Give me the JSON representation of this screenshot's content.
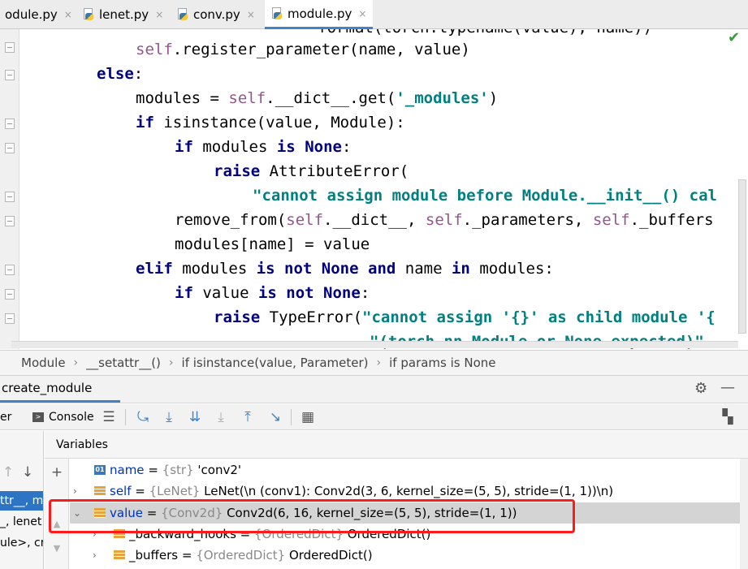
{
  "tabs": [
    {
      "label": "odule.py",
      "active": false
    },
    {
      "label": "lenet.py",
      "active": false
    },
    {
      "label": "conv.py",
      "active": false
    },
    {
      "label": "module.py",
      "active": true
    }
  ],
  "tab_close": "×",
  "editor": {
    "line0": "    \"format(torch.typename(value), name))",
    "line1_self": "self",
    "line1_rest": ".register_parameter(name, value)",
    "line2_kw": "else",
    "line2_rest": ":",
    "line3_a": "modules = ",
    "line3_self": "self",
    "line3_b": ".__dict__.get(",
    "line3_str": "'_modules'",
    "line3_c": ")",
    "line4_kw": "if",
    "line4_rest": " isinstance(value, Module):",
    "line5_kw1": "if",
    "line5_mid": " modules ",
    "line5_kw2": "is",
    "line5_sp": " ",
    "line5_kw3": "None",
    "line5_end": ":",
    "line6_kw": "raise",
    "line6_rest": " AttributeError(",
    "line7_str": "\"cannot assign module before Module.__init__() cal",
    "line8_a": "remove_from(",
    "line8_self1": "self",
    "line8_b": ".__dict__, ",
    "line8_self2": "self",
    "line8_c": "._parameters, ",
    "line8_self3": "self",
    "line8_d": "._buffers",
    "line9": "modules[name] = value",
    "line10_kw1": "elif",
    "line10_a": " modules ",
    "line10_kw2": "is not None",
    "line10_sp": " ",
    "line10_kw3": "and",
    "line10_b": " name ",
    "line10_kw4": "in",
    "line10_c": " modules:",
    "line11_kw1": "if",
    "line11_a": " value ",
    "line11_kw2": "is not None",
    "line11_b": ":",
    "line12_kw": "raise",
    "line12_a": " TypeError(",
    "line12_str": "\"cannot assign '{}' as child module '{",
    "line13_str": "\"(torch.nn.Module or None expected)\"",
    "check": "✔"
  },
  "breadcrumb": [
    "Module",
    "__setattr__()",
    "if isinstance(value, Parameter)",
    "if params is None"
  ],
  "debug": {
    "title": "create_module",
    "gear": "⚙",
    "minimize": "—",
    "debugger_tab": "er",
    "console_tab": "Console",
    "variables_label": "Variables",
    "frames": [
      "ttr__, m",
      "_, lenet",
      "ule>, cr"
    ],
    "variables": [
      {
        "name": "name",
        "type": "{str}",
        "value": "'conv2'",
        "icon": "01"
      },
      {
        "name": "self",
        "type": "{LeNet}",
        "value": "LeNet(\\n  (conv1): Conv2d(3, 6, kernel_size=(5, 5), stride=(1, 1))\\n)"
      },
      {
        "name": "value",
        "type": "{Conv2d}",
        "value": "Conv2d(6, 16, kernel_size=(5, 5), stride=(1, 1))"
      },
      {
        "name": "_backward_hooks",
        "type": "{OrderedDict}",
        "value": "OrderedDict()"
      },
      {
        "name": "_buffers",
        "type": "{OrderedDict}",
        "value": "OrderedDict()"
      }
    ],
    "eq": " = "
  },
  "colors": {
    "accent": "#4083c9",
    "highlight": "#ff1a1a"
  }
}
